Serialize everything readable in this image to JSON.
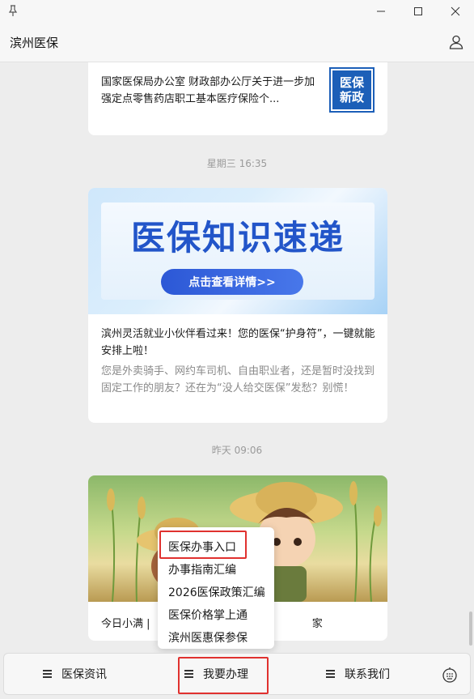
{
  "app": {
    "title": "滨州医保"
  },
  "messages": {
    "news": {
      "text": "国家医保局办公室  财政部办公厅关于进一步加强定点零售药店职工基本医疗保险个...",
      "badge_line1": "医保",
      "badge_line2": "新政"
    },
    "time1": "星期三 16:35",
    "article": {
      "banner_title": "医保知识速递",
      "banner_button": "点击查看详情>>",
      "title": "滨州灵活就业小伙伴看过来！您的医保“护身符”，一键就能安排上啦！",
      "description": "您是外卖骑手、网约车司机、自由职业者，还是暂时没找到固定工作的朋友？还在为“没人给交医保”发愁？别慌！"
    },
    "time2": "昨天 09:06",
    "photo_card": {
      "text_left": "今日小满 |",
      "text_right": "家"
    }
  },
  "popup_menu": {
    "items": [
      "医保办事入口",
      "办事指南汇编",
      "2026医保政策汇编",
      "医保价格掌上通",
      "滨州医惠保参保"
    ]
  },
  "bottom_bar": {
    "tabs": [
      "医保资讯",
      "我要办理",
      "联系我们"
    ]
  },
  "colors": {
    "highlight": "#e0312f",
    "brand_blue": "#1c5fb8",
    "background": "#ededed"
  },
  "icons": [
    "pin-icon",
    "minimize-icon",
    "maximize-icon",
    "close-icon",
    "user-icon",
    "menu-icon",
    "keyboard-icon"
  ]
}
